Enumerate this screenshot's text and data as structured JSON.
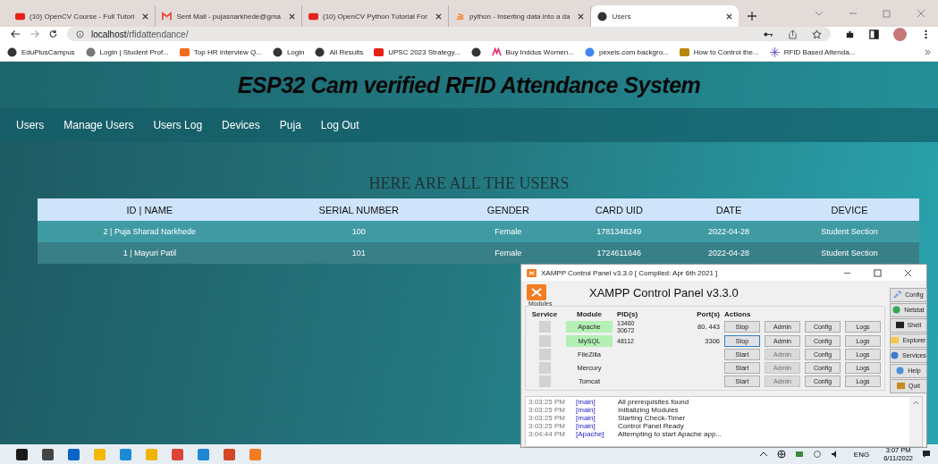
{
  "browser": {
    "tabs": [
      {
        "title": "(10) OpenCV Course - Full Tutori",
        "selected": false
      },
      {
        "title": "Sent Mail - pujasnarkhede@gma",
        "selected": false
      },
      {
        "title": "(10) OpenCV Python Tutorial For",
        "selected": false
      },
      {
        "title": "python - Inserting data into a da",
        "selected": false
      },
      {
        "title": "Users",
        "selected": true
      }
    ],
    "address": {
      "host": "localhost",
      "path": "/rfidattendance/"
    },
    "bookmarks": [
      {
        "label": "EduPlusCampus"
      },
      {
        "label": "Login | Student Prof..."
      },
      {
        "label": "Top HR Interview Q..."
      },
      {
        "label": "Login"
      },
      {
        "label": "All Results"
      },
      {
        "label": "UPSC 2023 Strategy..."
      },
      {
        "label": "Buy Inddus Women..."
      },
      {
        "label": "pexels.com backgro..."
      },
      {
        "label": "How to Control the..."
      },
      {
        "label": "RFID Based Attenda..."
      }
    ]
  },
  "page": {
    "title": "ESP32 Cam verified RFID Attendance System",
    "nav": [
      "Users",
      "Manage Users",
      "Users Log",
      "Devices",
      "Puja",
      "Log Out"
    ],
    "heading": "HERE ARE ALL THE USERS",
    "table": {
      "columns": [
        "ID | NAME",
        "SERIAL NUMBER",
        "GENDER",
        "CARD UID",
        "DATE",
        "DEVICE"
      ],
      "rows": [
        [
          "2 | Puja Sharad Narkhede",
          "100",
          "Female",
          "1781348249",
          "2022-04-28",
          "Student Section"
        ],
        [
          "1 | Mayuri Patil",
          "101",
          "Female",
          "1724611646",
          "2022-04-28",
          "Student Section"
        ]
      ]
    }
  },
  "xampp": {
    "window_title": "XAMPP Control Panel v3.3.0 [ Compiled: Apr 6th 2021 ]",
    "header": "XAMPP Control Panel v3.3.0",
    "group_label": "Modules",
    "columns": [
      "Service",
      "Module",
      "PID(s)",
      "Port(s)",
      "Actions"
    ],
    "modules": [
      {
        "name": "Apache",
        "checked": false,
        "running": true,
        "pids": [
          "13460",
          "30672"
        ],
        "ports": "80, 443",
        "action": "Stop",
        "focused": false,
        "admin": "Admin",
        "config": "Config",
        "logs": "Logs"
      },
      {
        "name": "MySQL",
        "checked": false,
        "running": true,
        "pids": [
          "48112"
        ],
        "ports": "3306",
        "action": "Stop",
        "focused": true,
        "admin": "Admin",
        "config": "Config",
        "logs": "Logs"
      },
      {
        "name": "FileZilla",
        "checked": false,
        "running": false,
        "action": "Start",
        "focused": false,
        "admin": "Admin",
        "config": "Config",
        "logs": "Logs"
      },
      {
        "name": "Mercury",
        "checked": false,
        "running": false,
        "action": "Start",
        "focused": false,
        "admin": "Admin",
        "config": "Config",
        "logs": "Logs"
      },
      {
        "name": "Tomcat",
        "checked": false,
        "running": false,
        "action": "Start",
        "focused": false,
        "admin": "Admin",
        "config": "Config",
        "logs": "Logs"
      }
    ],
    "side_buttons": [
      "Config",
      "Netstat",
      "Shell",
      "Explorer",
      "Services",
      "Help",
      "Quit"
    ],
    "log": [
      {
        "time": "3:03:25 PM",
        "source": "[main]",
        "message": "All prerequisites found"
      },
      {
        "time": "3:03:25 PM",
        "source": "[main]",
        "message": "Initializing Modules"
      },
      {
        "time": "3:03:25 PM",
        "source": "[main]",
        "message": "Starting Check-Timer"
      },
      {
        "time": "3:03:25 PM",
        "source": "[main]",
        "message": "Control Panel Ready"
      },
      {
        "time": "3:04:44 PM",
        "source": "[Apache]",
        "message": "Attempting to start Apache app..."
      }
    ]
  },
  "taskbar": {
    "language": "ENG",
    "time": "3:07 PM",
    "date": "6/11/2022"
  }
}
